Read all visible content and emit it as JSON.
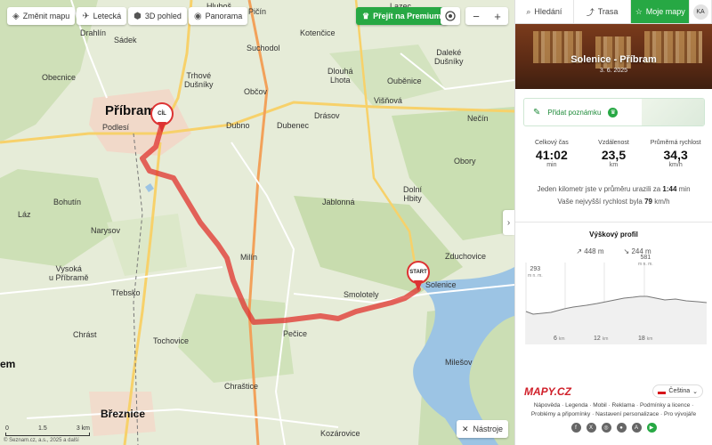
{
  "toolbar": {
    "change_map": "Změnit mapu",
    "aerial": "Letecká",
    "view3d": "3D pohled",
    "panorama": "Panorama"
  },
  "premium": "Přejít na Premium",
  "zoom": {
    "out": "−",
    "in": "+"
  },
  "tools": "Nástroje",
  "scale": {
    "a": "0",
    "b": "1.5",
    "c": "3 km"
  },
  "copyright": "© Seznam.cz, a.s., 2025 a další",
  "pins": {
    "finish": "CÍL",
    "start": "START"
  },
  "places": {
    "pribram": "Příbram",
    "breznice": "Březnice",
    "drahlin": "Drahlín",
    "sadek": "Sádek",
    "obecnice": "Obecnice",
    "podlesi": "Podlesí",
    "bohutin": "Bohutín",
    "laz": "Láz",
    "narysov": "Narysov",
    "vysoka": "Vysoká\nu Příbramě",
    "trebsko": "Třebsko",
    "chrast": "Chrást",
    "tochovice": "Tochovice",
    "chrastice": "Chraštice",
    "milin": "Milín",
    "pecice": "Pečice",
    "smolotely": "Smolotely",
    "jablonna": "Jablonná",
    "dolni_hbity": "Dolní\nHbity",
    "zduchovice": "Zduchovice",
    "solenice": "Solenice",
    "milesov": "Milešov",
    "kozarovice": "Kozárovice",
    "obory": "Obory",
    "necin": "Nečín",
    "drasov": "Drásov",
    "dubenec": "Dubenec",
    "dubno": "Dubno",
    "obcov": "Občov",
    "trhove": "Trhové\nDušníky",
    "suchodol": "Suchodol",
    "kotencice": "Kotenčice",
    "dlouha": "Dlouhá\nLhota",
    "oubenice": "Ouběnice",
    "visnova": "Višňová",
    "dalece": "Daleké\nDušníky",
    "picin": "Pičín",
    "hlubos": "Hluboš",
    "lazec": "Lazec",
    "em": "em"
  },
  "panel": {
    "tabs": {
      "search": "Hledání",
      "route": "Trasa",
      "my_maps": "Moje mapy",
      "avatar": "KA"
    },
    "title": "Solenice - Příbram",
    "date": "3. 6. 2025",
    "add_note": "Přidat poznámku",
    "stats": [
      {
        "label": "Celkový čas",
        "value": "41:02",
        "unit": "min"
      },
      {
        "label": "Vzdálenost",
        "value": "23,5",
        "unit": "km"
      },
      {
        "label": "Průměrná rychlost",
        "value": "34,3",
        "unit": "km/h"
      }
    ],
    "summary_line1_pre": "Jeden kilometr jste v průměru urazili za ",
    "summary_line1_val": "1:44",
    "summary_line1_post": " min",
    "summary_line2_pre": "Vaše nejvyšší rychlost byla ",
    "summary_line2_val": "79",
    "summary_line2_post": " km/h",
    "profile_title": "Výškový profil",
    "ascent": "448 m",
    "descent": "244 m",
    "elev_min": "293",
    "elev_max": "581",
    "elev_unit": "m n. m.",
    "ticks": [
      "6",
      "12",
      "18"
    ],
    "tick_unit": "km",
    "brand": "MAPY.CZ",
    "language": "Čeština",
    "links1": "Nápověda · Legenda · Mobil · Reklama · Podmínky a licence ·",
    "links2": "Problémy a připomínky · Nastavení personalizace · Pro vývojáře"
  },
  "colors": {
    "green": "#27a844",
    "route": "#e0332e",
    "brand": "#d0202a"
  }
}
